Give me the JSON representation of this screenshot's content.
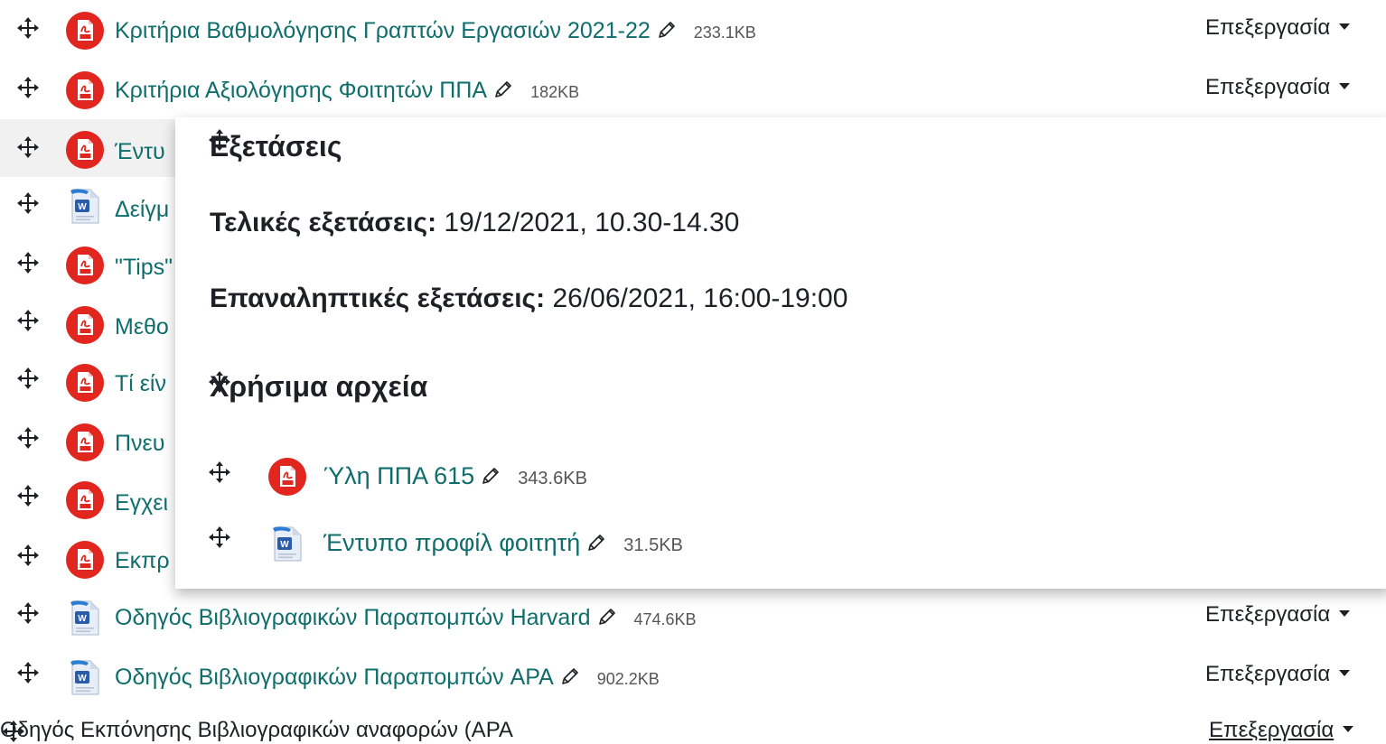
{
  "files": [
    {
      "name": "Κριτήρια Βαθμολόγησης Γραπτών Εργασιών 2021-22",
      "size": "233.1KB",
      "type": "pdf",
      "edit": "Επεξεργασία"
    },
    {
      "name": "Κριτήρια Αξιολόγησης Φοιτητών ΠΠΑ",
      "size": "182KB",
      "type": "pdf",
      "edit": "Επεξεργασία"
    },
    {
      "name": "Έντυ",
      "type": "pdf"
    },
    {
      "name": "Δείγμ",
      "type": "word"
    },
    {
      "name": "\"Tips\"",
      "type": "pdf"
    },
    {
      "name": "Μεθο",
      "type": "pdf"
    },
    {
      "name": "Τί είν",
      "type": "pdf"
    },
    {
      "name": "Πνευ",
      "type": "pdf"
    },
    {
      "name": "Εγχει",
      "type": "pdf"
    },
    {
      "name": "Εκπρ",
      "type": "pdf"
    },
    {
      "name": "Οδηγός Βιβλιογραφικών Παραπομπών Harvard",
      "size": "474.6KB",
      "type": "word",
      "edit": "Επεξεργασία"
    },
    {
      "name": "Οδηγός Βιβλιογραφικών Παραπομπών APA",
      "size": "902.2KB",
      "type": "word",
      "edit": "Επεξεργασία"
    }
  ],
  "bottom": {
    "text": "Οδηγός Εκπόνησης Βιβλιογραφικών αναφορών (APA",
    "edit": "Επεξεργασία"
  },
  "popup": {
    "heading1": "Εξετάσεις",
    "final_label": "Τελικές εξετάσεις:",
    "final_value": " 19/12/2021, 10.30-14.30",
    "repeat_label": "Επαναληπτικές εξετάσεις:",
    "repeat_value": " 26/06/2021, 16:00-19:00",
    "heading2": "Χρήσιμα αρχεία",
    "files": [
      {
        "name": "Ύλη ΠΠΑ 615",
        "size": "343.6KB",
        "type": "pdf"
      },
      {
        "name": "Έντυπο προφίλ φοιτητή",
        "size": "31.5KB",
        "type": "word"
      }
    ]
  },
  "colors": {
    "link": "#0f6e6c",
    "pdf": "#e0261f",
    "highlight": "#f1f1f1"
  },
  "icons": {
    "move": "move-icon",
    "edit": "pencil-icon",
    "pdf": "pdf-icon",
    "word": "word-icon"
  }
}
